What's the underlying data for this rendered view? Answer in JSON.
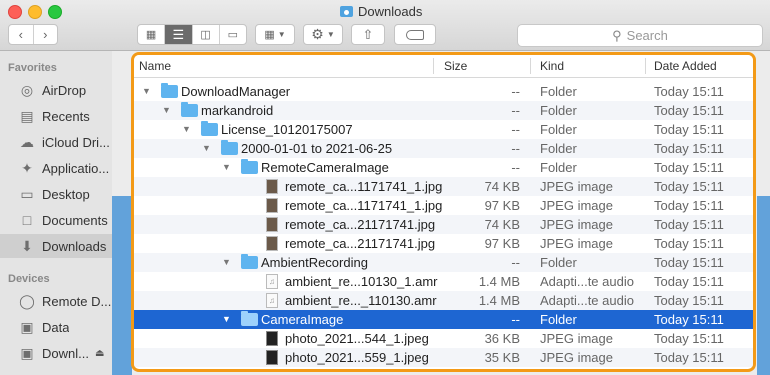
{
  "window": {
    "title": "Downloads"
  },
  "toolbar": {
    "search_placeholder": "Search"
  },
  "sidebar": {
    "favorites_heading": "Favorites",
    "favorites": [
      {
        "label": "AirDrop",
        "icon": "airdrop-icon"
      },
      {
        "label": "Recents",
        "icon": "clock-icon"
      },
      {
        "label": "iCloud Dri...",
        "icon": "cloud-icon"
      },
      {
        "label": "Applicatio...",
        "icon": "applications-icon"
      },
      {
        "label": "Desktop",
        "icon": "desktop-icon"
      },
      {
        "label": "Documents",
        "icon": "document-icon"
      },
      {
        "label": "Downloads",
        "icon": "download-icon",
        "selected": true
      }
    ],
    "devices_heading": "Devices",
    "devices": [
      {
        "label": "Remote D...",
        "icon": "display-icon"
      },
      {
        "label": "Data",
        "icon": "disk-icon"
      },
      {
        "label": "Downl...",
        "icon": "disk-icon"
      }
    ]
  },
  "columns": {
    "name": "Name",
    "size": "Size",
    "kind": "Kind",
    "date": "Date Added"
  },
  "rows": [
    {
      "name": "DownloadManager",
      "size": "--",
      "kind": "Folder",
      "date": "Today 15:11"
    },
    {
      "name": "markandroid",
      "size": "--",
      "kind": "Folder",
      "date": "Today 15:11"
    },
    {
      "name": "License_10120175007",
      "size": "--",
      "kind": "Folder",
      "date": "Today 15:11"
    },
    {
      "name": "2000-01-01 to 2021-06-25",
      "size": "--",
      "kind": "Folder",
      "date": "Today 15:11"
    },
    {
      "name": "RemoteCameraImage",
      "size": "--",
      "kind": "Folder",
      "date": "Today 15:11"
    },
    {
      "name": "remote_ca...1171741_1.jpg",
      "size": "74 KB",
      "kind": "JPEG image",
      "date": "Today 15:11"
    },
    {
      "name": "remote_ca...1171741_1.jpg",
      "size": "97 KB",
      "kind": "JPEG image",
      "date": "Today 15:11"
    },
    {
      "name": "remote_ca...21171741.jpg",
      "size": "74 KB",
      "kind": "JPEG image",
      "date": "Today 15:11"
    },
    {
      "name": "remote_ca...21171741.jpg",
      "size": "97 KB",
      "kind": "JPEG image",
      "date": "Today 15:11"
    },
    {
      "name": "AmbientRecording",
      "size": "--",
      "kind": "Folder",
      "date": "Today 15:11"
    },
    {
      "name": "ambient_re...10130_1.amr",
      "size": "1.4 MB",
      "kind": "Adapti...te audio",
      "date": "Today 15:11"
    },
    {
      "name": "ambient_re..._110130.amr",
      "size": "1.4 MB",
      "kind": "Adapti...te audio",
      "date": "Today 15:11"
    },
    {
      "name": "CameraImage",
      "size": "--",
      "kind": "Folder",
      "date": "Today 15:11"
    },
    {
      "name": "photo_2021...544_1.jpeg",
      "size": "36 KB",
      "kind": "JPEG image",
      "date": "Today 15:11"
    },
    {
      "name": "photo_2021...559_1.jpeg",
      "size": "35 KB",
      "kind": "JPEG image",
      "date": "Today 15:11"
    }
  ]
}
